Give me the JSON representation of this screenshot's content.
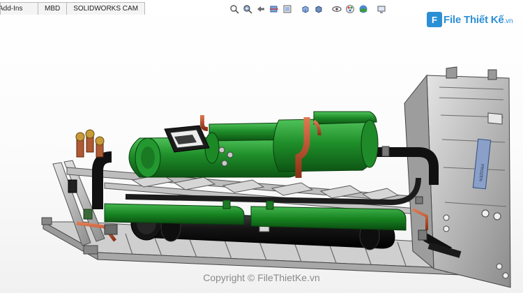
{
  "ribbon": {
    "tabs": [
      {
        "label": "Add-Ins"
      },
      {
        "label": "MBD"
      },
      {
        "label": "SOLIDWORKS CAM"
      }
    ]
  },
  "heads_up_toolbar": {
    "icons": [
      "zoom-to-fit",
      "zoom-to-area",
      "previous-view",
      "section-view",
      "dynamic-annotation-views",
      "view-orientation",
      "display-style",
      "hide-show-items",
      "edit-appearance",
      "apply-scene",
      "view-settings"
    ]
  },
  "watermark": {
    "logo_mark": "F",
    "logo_name": "File Thiết Kế",
    "logo_domain": ".vn",
    "copyright": "Copyright © FileThietKe.vn"
  },
  "model_nameplate": {
    "text": "FROZEN"
  },
  "colors": {
    "frame": "#b7b7b7",
    "compressor": "#1f8f2a",
    "pipe": "#151515",
    "copper": "#c8552f",
    "brand": "#2b8fd6"
  }
}
